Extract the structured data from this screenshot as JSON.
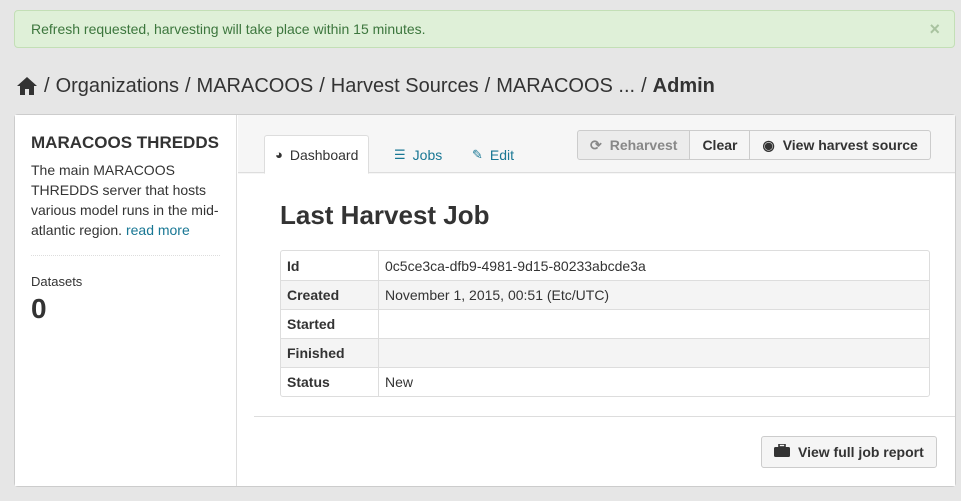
{
  "alert": {
    "message": "Refresh requested, harvesting will take place within 15 minutes.",
    "close": "×"
  },
  "breadcrumb": {
    "home_icon": "home-icon",
    "separator": "/",
    "items": [
      "Organizations",
      "MARACOOS",
      "Harvest Sources",
      "MARACOOS ..."
    ],
    "active": "Admin"
  },
  "sidebar": {
    "title": "MARACOOS THREDDS",
    "description": "The main MARACOOS THREDDS server that hosts various model runs in the mid-atlantic region.",
    "read_more": "read more",
    "stat_label": "Datasets",
    "stat_value": "0"
  },
  "tabs": [
    {
      "label": "Dashboard",
      "icon": "dashboard-icon",
      "glyph": "◕",
      "active": true
    },
    {
      "label": "Jobs",
      "icon": "list-icon",
      "glyph": "☰",
      "active": false
    },
    {
      "label": "Edit",
      "icon": "edit-icon",
      "glyph": "✎",
      "active": false
    }
  ],
  "actions": {
    "reharvest": "Reharvest",
    "reharvest_glyph": "⟳",
    "clear": "Clear",
    "view_source": "View harvest source",
    "view_glyph": "◉"
  },
  "job": {
    "heading": "Last Harvest Job",
    "rows": [
      {
        "key": "Id",
        "value": "0c5ce3ca-dfb9-4981-9d15-80233abcde3a"
      },
      {
        "key": "Created",
        "value": "November 1, 2015, 00:51 (Etc/UTC)"
      },
      {
        "key": "Started",
        "value": ""
      },
      {
        "key": "Finished",
        "value": ""
      },
      {
        "key": "Status",
        "value": "New"
      }
    ],
    "report_button": "View full job report",
    "report_glyph": "▬"
  },
  "colors": {
    "link": "#187794",
    "alert_bg": "#dff0d8",
    "alert_text": "#3c763d"
  }
}
